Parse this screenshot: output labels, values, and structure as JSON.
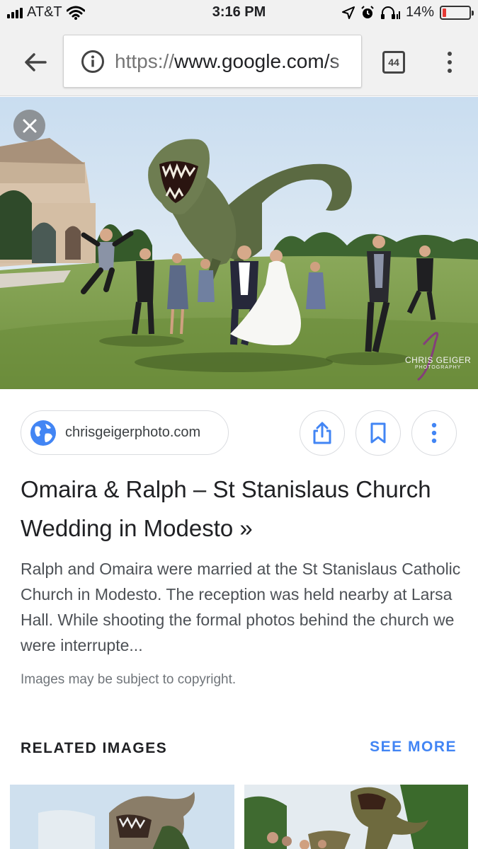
{
  "status_bar": {
    "carrier": "AT&T",
    "time": "3:16 PM",
    "battery_percent": "14%",
    "battery_level": 0.14,
    "icons": [
      "signal-icon",
      "wifi-icon",
      "location-icon",
      "alarm-icon",
      "headphones-icon",
      "battery-icon"
    ]
  },
  "browser": {
    "url_scheme": "https://",
    "url_host": "www.google.com/s",
    "tab_count": "44"
  },
  "viewer": {
    "watermark_line1": "CHRIS GEIGER",
    "watermark_line2": "PHOTOGRAPHY"
  },
  "result": {
    "source": "chrisgeigerphoto.com",
    "title": "Omaira & Ralph – St Stanislaus Church Wedding in Modesto »",
    "snippet": "Ralph and Omaira were married at the St Stanislaus Catholic Church in Modesto. The reception was held nearby at Larsa Hall. While shooting the formal photos behind the church we were interrupte...",
    "copyright": "Images may be subject to copyright."
  },
  "related": {
    "heading": "RELATED IMAGES",
    "see_more": "SEE MORE"
  },
  "colors": {
    "accent": "#4285f4",
    "battery_low": "#e53935"
  }
}
